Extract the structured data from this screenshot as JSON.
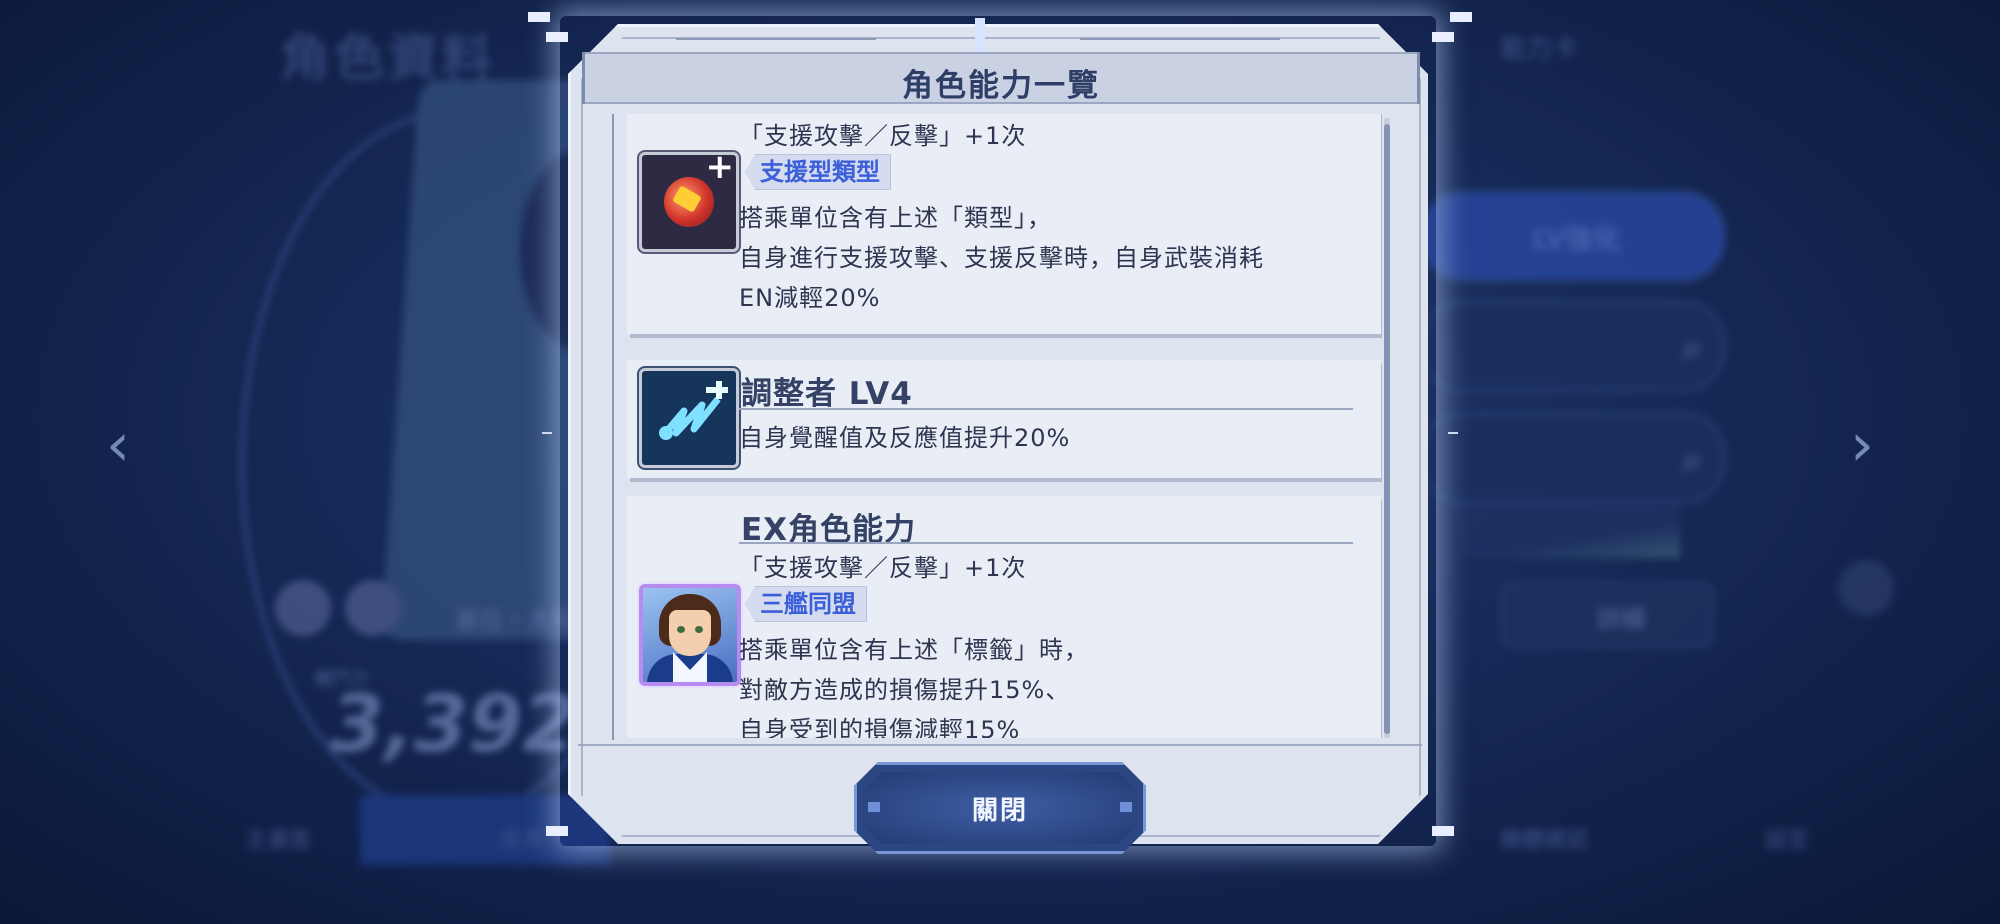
{
  "background": {
    "screen_title": "角色資料",
    "power_label": "戰鬥力",
    "power_value": "3,392",
    "left_arrow": "‹",
    "right_arrow": "›",
    "lv_button": "LV強化",
    "detail_button": "詳細",
    "pilot_name": "基拉・大和",
    "tab_home": "主畫面",
    "tab_other": "成長",
    "tab_right": "機體確認",
    "tab_far_right": "設定",
    "currency_label": "能力卡"
  },
  "dialog": {
    "title": "角色能力一覽",
    "close_label": "關閉"
  },
  "abilities": [
    {
      "icon": "support-type-icon",
      "lines_top": "「支援攻擊／反擊」+1次",
      "tag": "支援型類型",
      "desc": [
        "搭乘單位含有上述「類型」，",
        "自身進行支援攻擊、支援反擊時，自身武裝消耗",
        "EN減輕20%"
      ]
    },
    {
      "icon": "coordinator-icon",
      "heading": "調整者 LV4",
      "desc": [
        "自身覺醒值及反應值提升20%"
      ]
    },
    {
      "icon": "character-portrait",
      "heading": "EX角色能力",
      "lines_top": "「支援攻擊／反擊」+1次",
      "tag": "三艦同盟",
      "desc": [
        "搭乘單位含有上述「標籤」時，",
        "對敵方造成的損傷提升15%、",
        "自身受到的損傷減輕15%"
      ]
    }
  ],
  "colors": {
    "accent_blue": "#3a5fd8",
    "dialog_bg": "#dde3ef",
    "button_bg": "#2b4682"
  }
}
